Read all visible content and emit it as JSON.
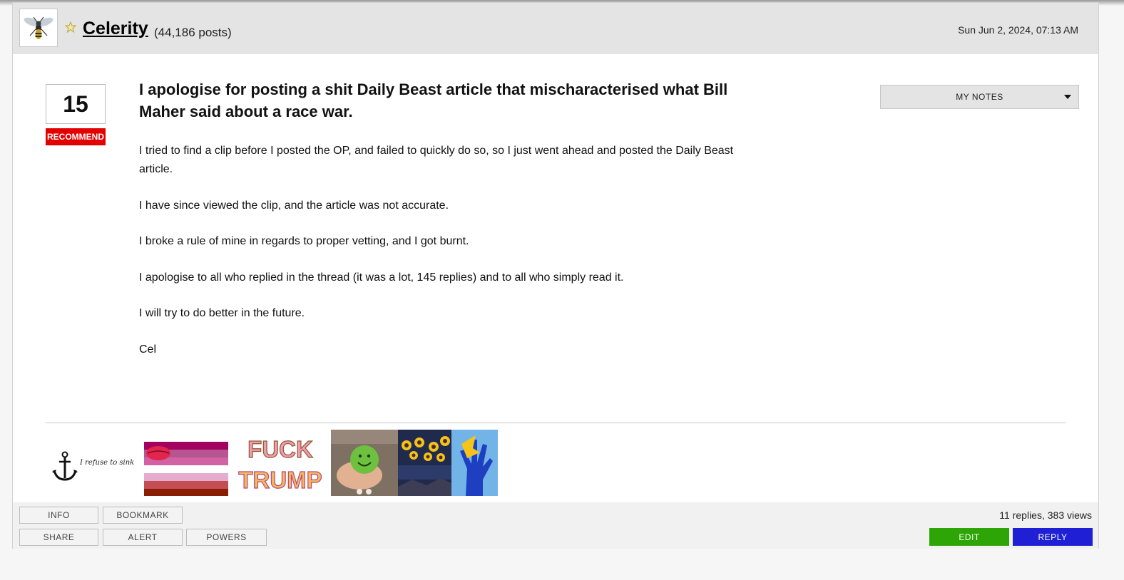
{
  "author": {
    "name": "Celerity",
    "post_count": "(44,186 posts)"
  },
  "date": "Sun Jun 2, 2024, 07:13 AM",
  "recommend": {
    "count": "15",
    "label": "RECOMMEND"
  },
  "post": {
    "title": "I apologise for posting a shit Daily Beast article that mischaracterised what Bill Maher said about a race war.",
    "paragraphs": [
      "I tried to find a clip before I posted the OP, and failed to quickly do so, so I just went ahead and posted the Daily Beast article.",
      "I have since viewed the clip, and the article was not accurate.",
      "I broke a rule of mine in regards to proper vetting, and I got burnt.",
      "I apologise to all who replied in the thread (it was a lot, 145 replies) and to all who simply read it.",
      "I will try to do better in the future.",
      "Cel"
    ]
  },
  "notes_dropdown": {
    "label": "MY NOTES"
  },
  "signature": {
    "anchor_text": "I refuse to sink",
    "protest_text": [
      "FUCK",
      "TRUMP"
    ]
  },
  "footer": {
    "buttons": {
      "info": "INFO",
      "bookmark": "BOOKMARK",
      "share": "SHARE",
      "alert": "ALERT",
      "powers": "POWERS"
    },
    "stats": "11 replies, 383 views",
    "edit": "EDIT",
    "reply": "REPLY"
  },
  "colors": {
    "recommend_red": "#e30000",
    "edit_green": "#2ea507",
    "reply_blue": "#1f1fd6",
    "header_gray": "#e4e4e4"
  }
}
